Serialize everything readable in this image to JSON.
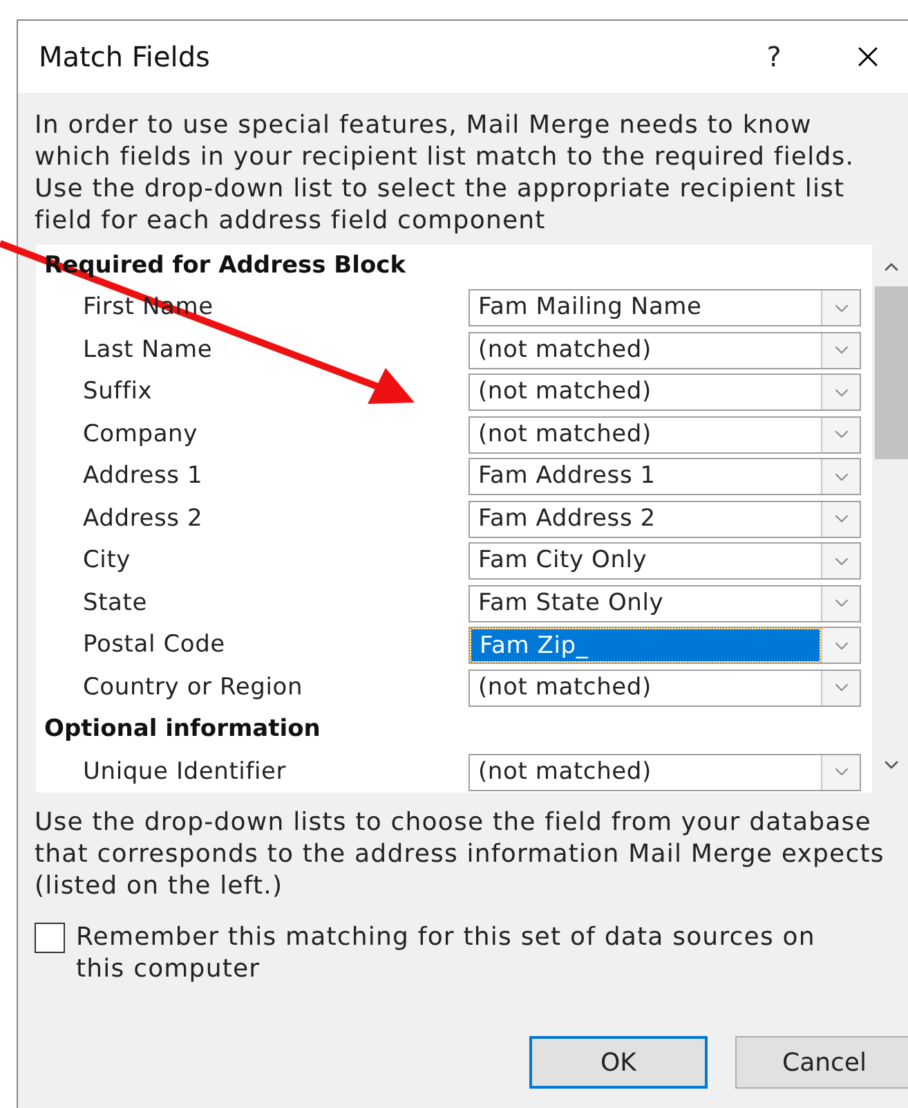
{
  "window": {
    "title": "Match Fields",
    "help": "?"
  },
  "intro": "In order to use special features, Mail Merge needs to know which fields in your recipient list match to the required fields.  Use the drop-down list to select the appropriate recipient list field for each address field component",
  "fields": [
    {
      "kind": "heading",
      "label": "Required for Address Block"
    },
    {
      "kind": "field",
      "label": "First Name",
      "value": "Fam Mailing Name",
      "selected": false
    },
    {
      "kind": "field",
      "label": "Last Name",
      "value": "(not matched)",
      "selected": false
    },
    {
      "kind": "field",
      "label": "Suffix",
      "value": "(not matched)",
      "selected": false
    },
    {
      "kind": "field",
      "label": "Company",
      "value": "(not matched)",
      "selected": false
    },
    {
      "kind": "field",
      "label": "Address 1",
      "value": "Fam Address 1",
      "selected": false
    },
    {
      "kind": "field",
      "label": "Address 2",
      "value": "Fam Address 2",
      "selected": false
    },
    {
      "kind": "field",
      "label": "City",
      "value": "Fam City Only",
      "selected": false
    },
    {
      "kind": "field",
      "label": "State",
      "value": "Fam State Only",
      "selected": false
    },
    {
      "kind": "field",
      "label": "Postal Code",
      "value": "Fam Zip_",
      "selected": true
    },
    {
      "kind": "field",
      "label": "Country or Region",
      "value": "(not matched)",
      "selected": false
    },
    {
      "kind": "heading",
      "label": "Optional information"
    },
    {
      "kind": "field",
      "label": "Unique Identifier",
      "value": "(not matched)",
      "selected": false
    }
  ],
  "hint": "Use the drop-down lists to choose the field from your database that corresponds to the address information Mail Merge expects (listed on the left.)",
  "remember": {
    "label": "Remember this matching for this set of data sources on this computer",
    "checked": false
  },
  "buttons": [
    {
      "label": "OK",
      "default": true
    },
    {
      "label": "Cancel",
      "default": false
    }
  ]
}
